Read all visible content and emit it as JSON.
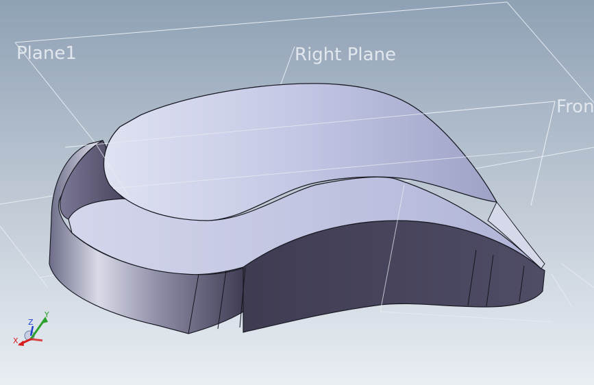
{
  "viewport": {
    "background_top": "#8fa1b5",
    "background_bottom": "#e9eef3"
  },
  "planes": {
    "plane1": "Plane1",
    "right": "Right Plane",
    "front": "Fron"
  },
  "triad": {
    "x_label": "X",
    "y_label": "Y",
    "z_label": "Z",
    "x_color": "#d81c1c",
    "y_color": "#2ca02c",
    "z_color": "#1f3fd0"
  },
  "model": {
    "top_face_color": "#b9bfe0",
    "side_wall_color": "#4a4660"
  }
}
